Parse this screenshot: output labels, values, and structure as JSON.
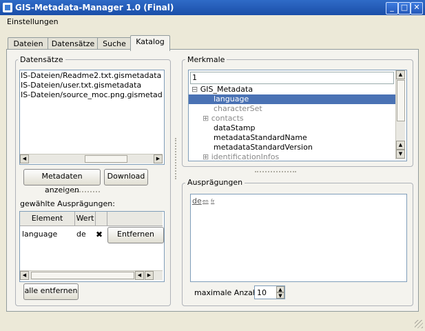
{
  "window": {
    "title": "GIS-Metadata-Manager 1.0 (Final)"
  },
  "menu": {
    "settings": "Einstellungen"
  },
  "tabs": [
    {
      "label": "Dateien"
    },
    {
      "label": "Datensätze"
    },
    {
      "label": "Suche"
    },
    {
      "label": "Katalog"
    }
  ],
  "datensaetze": {
    "title": "Datensätze",
    "items": [
      "IS-Dateien/Readme2.txt.gismetadata",
      "IS-Dateien/user.txt.gismetadata",
      "IS-Dateien/source_moc.png.gismetadata"
    ],
    "show_button": "Metadaten anzeigen",
    "download_button": "Download"
  },
  "selected": {
    "label": "gewählte Ausprägungen:",
    "columns": [
      "Element",
      "Wert"
    ],
    "rows": [
      {
        "element": "language",
        "value": "de",
        "remove": "Entfernen"
      }
    ],
    "remove_all": "alle entfernen"
  },
  "merkmale": {
    "title": "Merkmale",
    "search_value": "1",
    "tree": [
      {
        "label": "GIS_Metadata",
        "expander": "⊟"
      },
      {
        "label": "language"
      },
      {
        "label": "characterSet"
      },
      {
        "label": "contacts",
        "expander": "⊞"
      },
      {
        "label": "dataStamp"
      },
      {
        "label": "metadataStandardName"
      },
      {
        "label": "metadataStandardVersion"
      },
      {
        "label": "identificationInfos",
        "expander": "⊞"
      }
    ]
  },
  "auspraegungen": {
    "title": "Ausprägungen",
    "values": [
      "de",
      "en",
      "fr"
    ],
    "max_label": "maximale Anzahl:",
    "max_value": "10"
  },
  "colors": {
    "titlebar": "#2458b8",
    "selection": "#4a72b4"
  }
}
